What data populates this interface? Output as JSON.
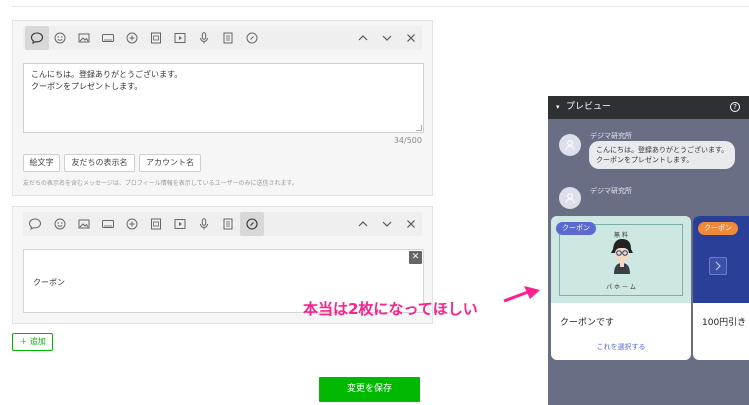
{
  "editor1": {
    "message_lines": [
      "こんにちは。登録ありがとうございます。",
      "クーポンをプレゼントします。"
    ],
    "char_count": "34/500",
    "chips": [
      "絵文字",
      "友だちの表示名",
      "アカウント名"
    ],
    "note": "友だちの表示名を含むメッセージは、プロフィール情報を表示しているユーザーのみに送信されます。"
  },
  "editor2": {
    "coupon_label": "クーポン",
    "close_symbol": "✕"
  },
  "add_button": "＋ 追加",
  "save_button": "変更を保存",
  "annotation": "本当は2枚になってほしい",
  "preview": {
    "title": "プレビュー",
    "toggle_symbol": "▾",
    "help_symbol": "?",
    "sender1": "デジマ研究所",
    "bubble_lines": [
      "こんにちは。登録ありがとうございます。",
      "クーポンをプレゼントします。"
    ],
    "sender2": "デジマ研究所",
    "cards": [
      {
        "tag": "クーポン",
        "name": "クーポンです",
        "link": "これを選択する",
        "img_heading": "無 料",
        "img_caption": "パ ホ ー ム"
      },
      {
        "tag": "クーポン",
        "name": "100円引き",
        "link": ""
      }
    ]
  },
  "colors": {
    "brand_green": "#00b900",
    "annotation_pink": "#ff1f8e",
    "preview_bg": "#6a6e85"
  }
}
